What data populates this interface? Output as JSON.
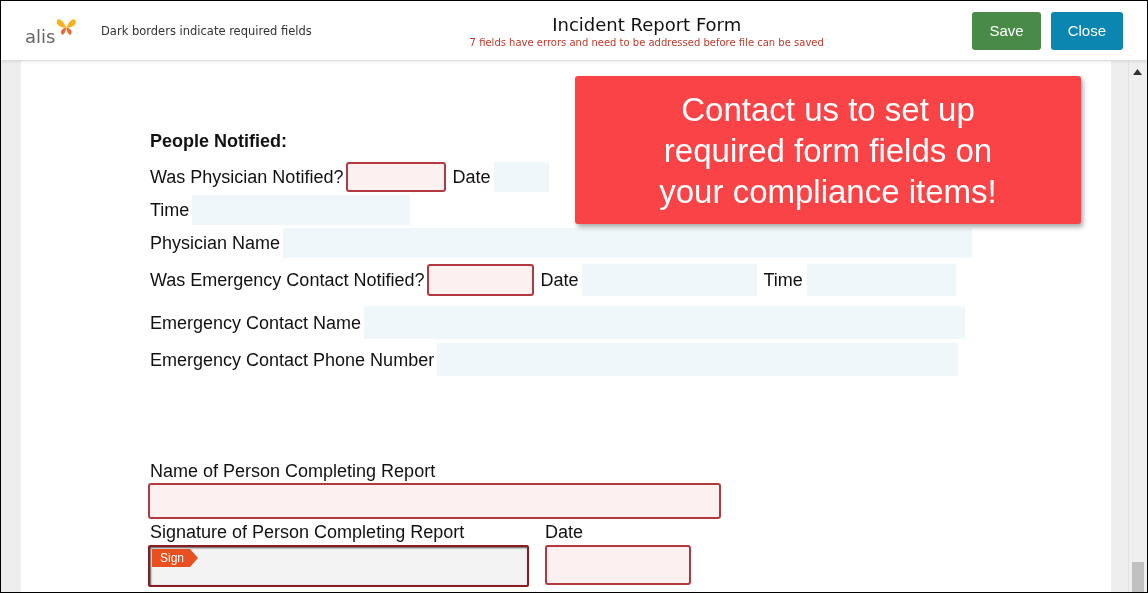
{
  "header": {
    "logo_text": "alis",
    "hint": "Dark borders indicate required fields",
    "title": "Incident Report Form",
    "error_message": "7 fields have errors and need to be addressed before file can be saved",
    "buttons": [
      {
        "label": "Save",
        "kind": "save"
      },
      {
        "label": "Close",
        "kind": "close"
      }
    ]
  },
  "form": {
    "section_title": "People Notified:",
    "rows": [
      {
        "items": [
          {
            "kind": "label",
            "text": "Was Physician Notified?"
          },
          {
            "kind": "field",
            "required": true
          },
          {
            "kind": "label",
            "text": "Date"
          },
          {
            "kind": "field",
            "required": false
          }
        ]
      },
      {
        "items": [
          {
            "kind": "label",
            "text": "Time"
          },
          {
            "kind": "field",
            "required": false
          }
        ]
      },
      {
        "items": [
          {
            "kind": "label",
            "text": "Physician Name"
          },
          {
            "kind": "field",
            "required": false
          }
        ]
      },
      {
        "items": [
          {
            "kind": "label",
            "text": "Was Emergency Contact Notified?"
          },
          {
            "kind": "field",
            "required": true
          },
          {
            "kind": "label",
            "text": "Date"
          },
          {
            "kind": "field",
            "required": false
          },
          {
            "kind": "label",
            "text": "Time"
          },
          {
            "kind": "field",
            "required": false
          }
        ]
      },
      {
        "items": [
          {
            "kind": "label",
            "text": "Emergency Contact Name"
          },
          {
            "kind": "field",
            "required": false
          }
        ]
      },
      {
        "items": [
          {
            "kind": "label",
            "text": "Emergency Contact Phone Number"
          },
          {
            "kind": "field",
            "required": false
          }
        ]
      }
    ],
    "completion": [
      {
        "label": "Name of Person Completing Report",
        "kind": "text",
        "required": true
      },
      {
        "label": "Signature of Person Completing Report",
        "kind": "signature",
        "required": true,
        "sign_tag": "Sign"
      },
      {
        "label": "Date",
        "kind": "text",
        "required": true
      }
    ]
  },
  "callout": {
    "text": "Contact us to set up required form fields on your compliance items!"
  }
}
